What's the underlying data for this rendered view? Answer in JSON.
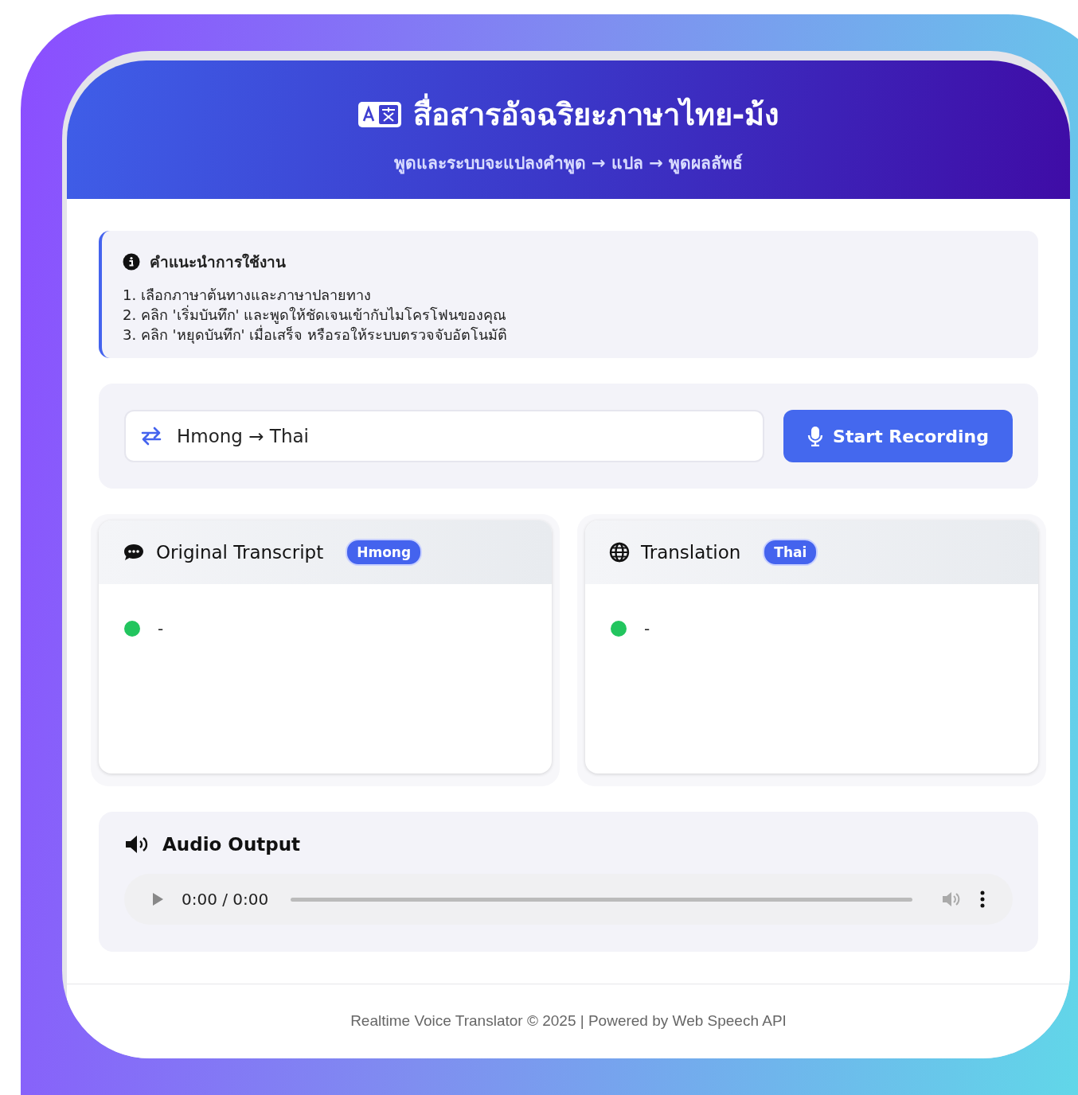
{
  "header": {
    "title": "สื่อสารอัจฉริยะภาษาไทย-ม้ง",
    "subtitle": "พูดและระบบจะแปลงคำพูด → แปล → พูดผลลัพธ์"
  },
  "instructions": {
    "title": "คำแนะนำการใช้งาน",
    "steps": [
      "1. เลือกภาษาต้นทางและภาษาปลายทาง",
      "2. คลิก 'เริ่มบันทึก' และพูดให้ชัดเจนเข้ากับไมโครโฟนของคุณ",
      "3. คลิก 'หยุดบันทึก' เมื่อเสร็จ หรือรอให้ระบบตรวจจับอัตโนมัติ"
    ]
  },
  "language_pair": {
    "label": "Hmong → Thai"
  },
  "record_button": {
    "label": "Start Recording"
  },
  "panels": [
    {
      "kind": "transcript",
      "title": "Original Transcript",
      "badge": "Hmong",
      "color": "#22c55e",
      "text": "-"
    },
    {
      "kind": "translation",
      "title": "Translation",
      "badge": "Thai",
      "color": "#22c55e",
      "text": "-"
    }
  ],
  "audio": {
    "title": "Audio Output",
    "time": "0:00 / 0:00"
  },
  "footer": "Realtime Voice Translator © 2025 | Powered by Web Speech API"
}
